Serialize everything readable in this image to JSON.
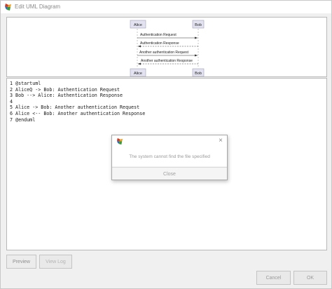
{
  "window": {
    "title": "Edit UML Diagram"
  },
  "preview": {
    "participants": [
      "Alice",
      "Bob"
    ],
    "messages": [
      {
        "label": "Authentication Request",
        "direction": "right",
        "style": "solid"
      },
      {
        "label": "Authentication Response",
        "direction": "left",
        "style": "dashed"
      },
      {
        "label": "Another authentication Request",
        "direction": "right",
        "style": "solid"
      },
      {
        "label": "Another authentication Response",
        "direction": "left",
        "style": "dashed"
      }
    ]
  },
  "editor": {
    "lines": [
      "1 @startuml",
      "2 AliceQ -> Bob: Authentication Request",
      "3 Bob --> Alice: Authentication Response",
      "4",
      "5 Alice -> Bob: Another authentication Request",
      "6 Alice <-- Bob: Another authentication Response",
      "7 @enduml"
    ]
  },
  "buttons": {
    "preview": "Preview",
    "view_log": "View Log",
    "cancel": "Cancel",
    "ok": "OK"
  },
  "dialog": {
    "message": "The system cannot find the file specified",
    "close_label": "Close",
    "close_icon": "×"
  },
  "colors": {
    "participant_fill": "#e2e2f0",
    "participant_border": "#a0a0b8",
    "lifeline": "#b0b0b0"
  }
}
